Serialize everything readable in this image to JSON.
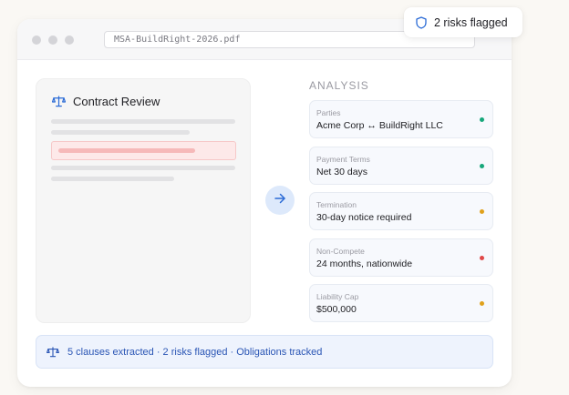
{
  "window": {
    "address": "MSA-BuildRight-2026.pdf"
  },
  "document": {
    "title": "Contract Review",
    "icon": "scale-icon"
  },
  "analysis": {
    "heading": "ANALYSIS",
    "fields": [
      {
        "label": "Parties",
        "value": "Acme Corp ↔ BuildRight LLC",
        "status_color": "#16a77a"
      },
      {
        "label": "Payment Terms",
        "value": "Net 30 days",
        "status_color": "#16a77a"
      },
      {
        "label": "Termination",
        "value": "30-day notice required",
        "status_color": "#e0a11b"
      },
      {
        "label": "Non-Compete",
        "value": "24 months, nationwide",
        "status_color": "#e04848"
      },
      {
        "label": "Liability Cap",
        "value": "$500,000",
        "status_color": "#e0a11b"
      }
    ]
  },
  "summary": {
    "text": "5 clauses extracted · 2 risks flagged · Obligations tracked",
    "icon": "scale-icon"
  },
  "badge": {
    "text": "2 risks flagged",
    "icon": "shield-icon"
  },
  "colors": {
    "accent": "#2b6bd6",
    "risk": "#f6b9b9"
  }
}
